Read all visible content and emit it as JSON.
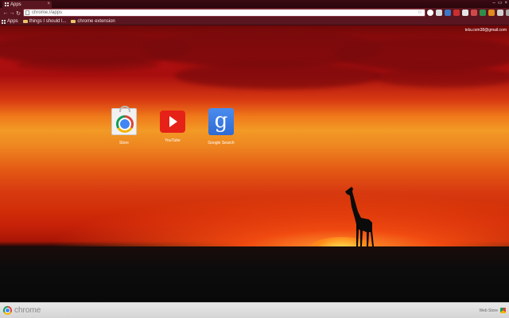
{
  "tab": {
    "title": "Apps",
    "close": "×"
  },
  "window_controls": [
    "–",
    "▭",
    "×"
  ],
  "toolbar": {
    "back": "←",
    "forward": "→",
    "reload": "↻",
    "url": "chrome://apps"
  },
  "bookmarks": {
    "apps_label": "Apps",
    "items": [
      "things I should l...",
      "chrome extension"
    ]
  },
  "account": {
    "email": "tela.com38@gmail.com"
  },
  "apps": [
    {
      "label": "Store",
      "icon": "chrome-web-store-icon"
    },
    {
      "label": "YouTube",
      "icon": "youtube-icon"
    },
    {
      "label": "Google Search",
      "icon": "google-search-icon"
    }
  ],
  "footer": {
    "brand": "chrome",
    "webstore": "Web Store"
  },
  "colors": {
    "frame": "#5a1620",
    "sky_top": "#b21010",
    "sky_glow": "#f29a26",
    "youtube": "#e62117",
    "google_blue": "#4285f4"
  }
}
